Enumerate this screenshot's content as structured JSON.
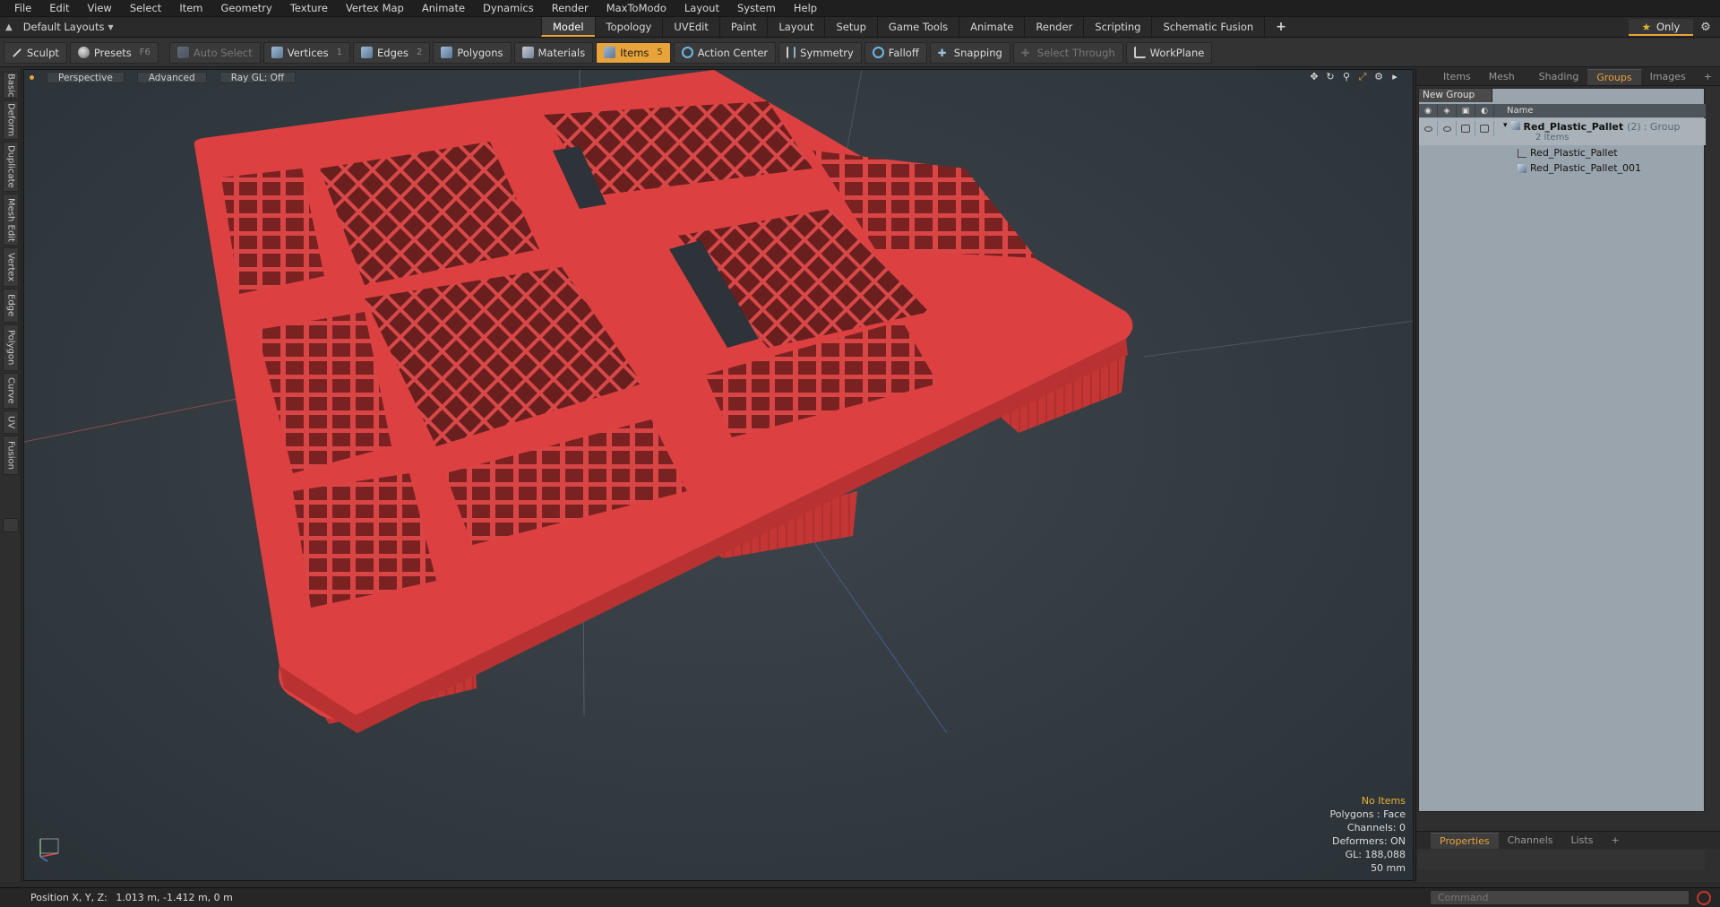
{
  "menubar": {
    "items": [
      "File",
      "Edit",
      "View",
      "Select",
      "Item",
      "Geometry",
      "Texture",
      "Vertex Map",
      "Animate",
      "Dynamics",
      "Render",
      "MaxToModo",
      "Layout",
      "System",
      "Help"
    ]
  },
  "layout": {
    "name": "Default Layouts",
    "tabs": [
      "Model",
      "Topology",
      "UVEdit",
      "Paint",
      "Layout",
      "Setup",
      "Game Tools",
      "Animate",
      "Render",
      "Scripting",
      "Schematic Fusion"
    ],
    "active_tab": "Model",
    "only_label": "Only"
  },
  "toolbar": {
    "sculpt": "Sculpt",
    "presets": "Presets",
    "presets_key": "F6",
    "auto_select": "Auto Select",
    "vertices": "Vertices",
    "vertices_key": "1",
    "edges": "Edges",
    "edges_key": "2",
    "polygons": "Polygons",
    "materials": "Materials",
    "items": "Items",
    "items_key": "5",
    "action_center": "Action Center",
    "symmetry": "Symmetry",
    "falloff": "Falloff",
    "snapping": "Snapping",
    "select_through": "Select Through",
    "workplane": "WorkPlane"
  },
  "left_tabs": [
    "Basic",
    "Deform",
    "Duplicate",
    "Mesh Edit",
    "Vertex",
    "Edge",
    "Polygon",
    "Curve",
    "UV",
    "Fusion"
  ],
  "viewport": {
    "view": "Perspective",
    "mode": "Advanced",
    "raygl": "Ray GL: Off",
    "stats": {
      "selection": "No Items",
      "polygons": "Polygons : Face",
      "channels": "Channels: 0",
      "deformers": "Deformers: ON",
      "gl": "GL: 188,088",
      "scale": "50 mm"
    },
    "accent": "#e8a33a",
    "pallet_color": "#d93b3b"
  },
  "right_panel": {
    "tabs": [
      "Items",
      "Mesh ...",
      "Shading",
      "Groups",
      "Images"
    ],
    "active_tab": "Groups",
    "new_group": "New Group",
    "name_column": "Name",
    "group": {
      "name": "Red_Plastic_Pallet",
      "count": "(2)",
      "type": ": Group",
      "items_label": "2 Items"
    },
    "children": [
      "Red_Plastic_Pallet",
      "Red_Plastic_Pallet_001"
    ]
  },
  "lower_panel": {
    "tabs": [
      "Properties",
      "Channels",
      "Lists"
    ],
    "active_tab": "Properties"
  },
  "statusbar": {
    "position_label": "Position X, Y, Z:",
    "position_value": "1.013 m, -1.412 m, 0 m",
    "command_placeholder": "Command"
  }
}
